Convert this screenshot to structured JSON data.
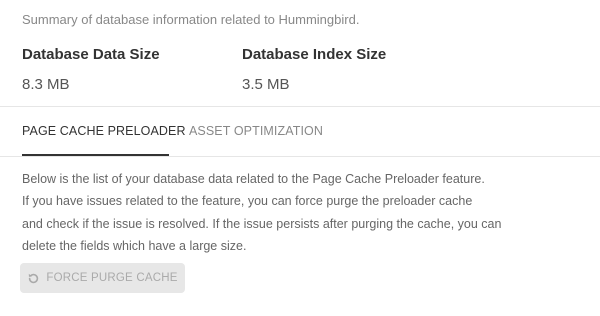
{
  "summary": {
    "text": "Summary of database information related to Hummingbird."
  },
  "stats": [
    {
      "label": "Database Data Size",
      "value": "8.3 MB"
    },
    {
      "label": "Database Index Size",
      "value": "3.5 MB"
    }
  ],
  "tabs": [
    {
      "label": "PAGE CACHE PRELOADER",
      "active": true
    },
    {
      "label": "ASSET OPTIMIZATION",
      "active": false
    }
  ],
  "description": {
    "lines": [
      "Below is the list of your database data related to the Page Cache Preloader feature.",
      "If you have issues related to the feature, you can force purge the preloader cache",
      "and check if the issue is resolved. If the issue persists after purging the cache, you can",
      "delete the fields which have a large size."
    ]
  },
  "button": {
    "label": "FORCE PURGE CACHE",
    "icon": "refresh-icon",
    "disabled": true
  },
  "colors": {
    "active_tab_underline": "#333333",
    "inactive_tab_text": "#888888",
    "disabled_button_bg": "#e7e7e7",
    "disabled_button_text": "#aaaaaa"
  }
}
